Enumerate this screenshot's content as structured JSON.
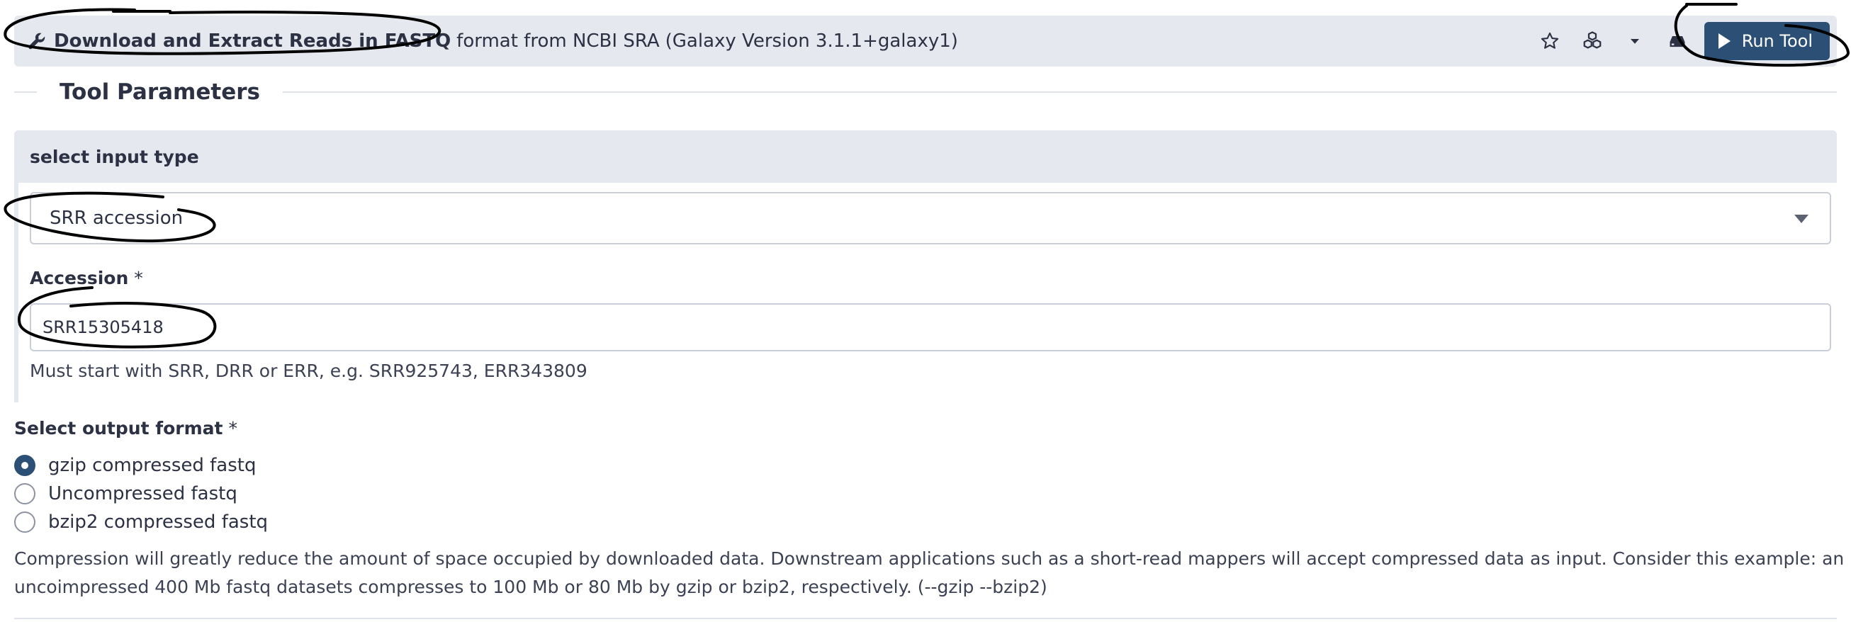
{
  "header": {
    "tool_name": "Download and Extract Reads in FASTQ",
    "tool_desc": "format from NCBI SRA",
    "version": "(Galaxy Version 3.1.1+galaxy1)",
    "run_label": "Run Tool"
  },
  "section": {
    "legend": "Tool Parameters"
  },
  "conditional": {
    "label": "select input type",
    "selected": "SRR accession"
  },
  "accession": {
    "label": "Accession",
    "required": "*",
    "value": "SRR15305418",
    "help": "Must start with SRR, DRR or ERR, e.g. SRR925743, ERR343809"
  },
  "output_format": {
    "label": "Select output format",
    "required": "*",
    "options": [
      {
        "label": "gzip compressed fastq",
        "checked": true
      },
      {
        "label": "Uncompressed fastq",
        "checked": false
      },
      {
        "label": "bzip2 compressed fastq",
        "checked": false
      }
    ],
    "help_line1": "Compression will greatly reduce the amount of space occupied by downloaded data. Downstream applications such as a short-read mappers will accept compressed data as input. Consider this example: an",
    "help_line2": "uncoimpressed 400 Mb fastq datasets compresses to 100 Mb or 80 Mb by gzip or bzip2, respectively. (--gzip --bzip2)"
  },
  "colors": {
    "primary": "#2c4f76",
    "header_bg": "#e5e8ee",
    "text": "#2c3143"
  },
  "icons": [
    "wrench-icon",
    "star-icon",
    "cubes-icon",
    "caret-down-icon",
    "storage-icon",
    "play-icon"
  ]
}
